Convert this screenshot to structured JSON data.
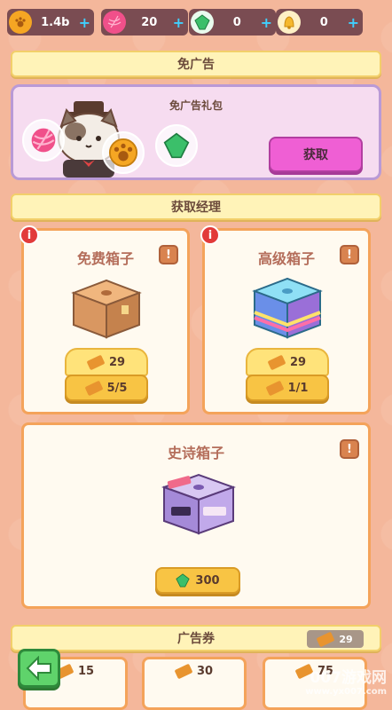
{
  "currencies": [
    {
      "value": "1.4b",
      "icon": "paw-coin-icon",
      "color": "#f5a623"
    },
    {
      "value": "20",
      "icon": "yarn-ball-icon",
      "color": "#f0508a"
    },
    {
      "value": "0",
      "icon": "green-gem-icon",
      "color": "#3bbf6a"
    },
    {
      "value": "0",
      "icon": "golden-bell-icon",
      "color": "#f5b82e"
    }
  ],
  "no_ads": {
    "title": "免广告",
    "package_label": "免广告礼包",
    "get_button": "获取"
  },
  "managers": {
    "title": "获取经理",
    "free_box": {
      "title": "免费箱子",
      "info": "!",
      "alert": "i",
      "ticket_cost": "29",
      "remaining": "5/5"
    },
    "premium_box": {
      "title": "高级箱子",
      "info": "!",
      "alert": "i",
      "ticket_cost": "29",
      "remaining": "1/1"
    },
    "epic_box": {
      "title": "史诗箱子",
      "info": "!",
      "gem_cost": "300"
    }
  },
  "vouchers": {
    "title": "广告券",
    "count": "29",
    "items": [
      {
        "amount": "15"
      },
      {
        "amount": "30"
      },
      {
        "amount": "75"
      }
    ]
  },
  "watermark": {
    "brand": "007游戏网",
    "url": "www.yx007.com"
  }
}
